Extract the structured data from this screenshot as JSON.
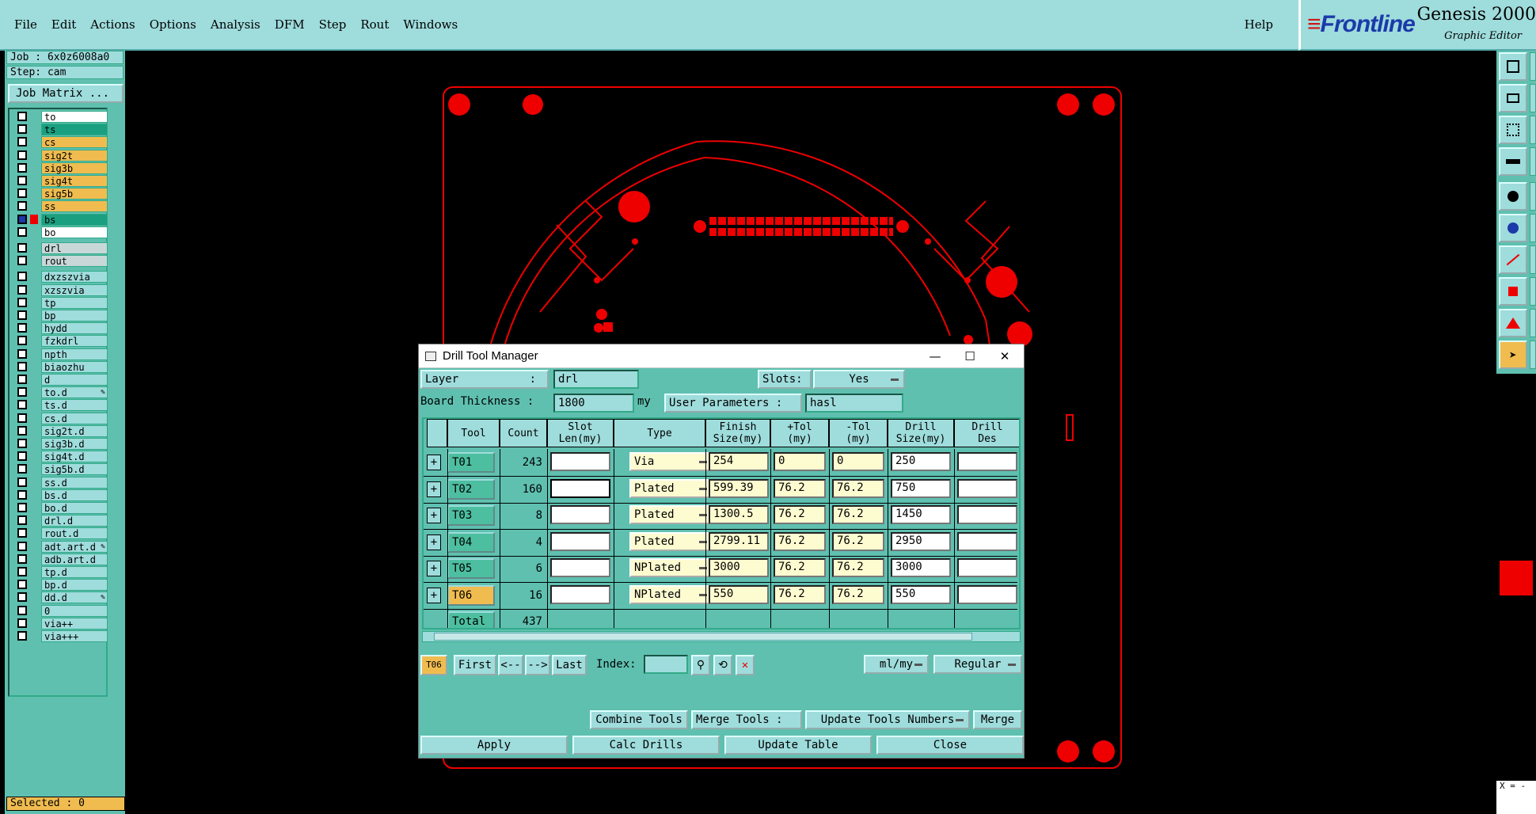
{
  "menubar": {
    "items": [
      "File",
      "Edit",
      "Actions",
      "Options",
      "Analysis",
      "DFM",
      "Step",
      "Rout",
      "Windows"
    ],
    "help": "Help"
  },
  "brand": {
    "logo": "Frontline",
    "product": "Genesis 2000",
    "subtitle": "Graphic Editor"
  },
  "job_info": {
    "job": "Job : 6x0z6008a0",
    "step": "Step: cam",
    "job_matrix_button": "Job Matrix ..."
  },
  "layers": [
    "to",
    "ts",
    "cs",
    "sig2t",
    "sig3b",
    "sig4t",
    "sig5b",
    "ss",
    "bs",
    "bo",
    "drl",
    "rout",
    "dxzszvia",
    "xzszvia",
    "tp",
    "bp",
    "hydd",
    "fzkdrl",
    "npth",
    "biaozhu",
    "d",
    "to.d",
    "ts.d",
    "cs.d",
    "sig2t.d",
    "sig3b.d",
    "sig4t.d",
    "sig5b.d",
    "ss.d",
    "bs.d",
    "bo.d",
    "drl.d",
    "rout.d",
    "adt.art.d",
    "adb.art.d",
    "tp.d",
    "bp.d",
    "dd.d",
    "0",
    "via++",
    "via+++"
  ],
  "selected": "Selected : 0",
  "coord_readout": "X = -",
  "dialog": {
    "title": "Drill Tool Manager",
    "layer_label": "Layer",
    "layer_colon": ":",
    "layer_value": "drl",
    "slots_label": "Slots:",
    "slots_value": "Yes",
    "board_thickness_label": "Board Thickness :",
    "board_thickness_value": "1800",
    "board_thickness_unit": "my",
    "user_params_label": "User Parameters :",
    "user_params_value": "hasl",
    "columns": [
      "Tool",
      "Count",
      "Slot\nLen(my)",
      "Type",
      "Finish\nSize(my)",
      "+Tol\n(my)",
      "-Tol\n(my)",
      "Drill\nSize(my)",
      "Drill\nDes"
    ],
    "rows": [
      {
        "tool": "T01",
        "count": "243",
        "type": "Via",
        "finish": "254",
        "ptol": "0",
        "ntol": "0",
        "drill": "250"
      },
      {
        "tool": "T02",
        "count": "160",
        "type": "Plated",
        "finish": "599.39",
        "ptol": "76.2",
        "ntol": "76.2",
        "drill": "750"
      },
      {
        "tool": "T03",
        "count": "8",
        "type": "Plated",
        "finish": "1300.5",
        "ptol": "76.2",
        "ntol": "76.2",
        "drill": "1450"
      },
      {
        "tool": "T04",
        "count": "4",
        "type": "Plated",
        "finish": "2799.11",
        "ptol": "76.2",
        "ntol": "76.2",
        "drill": "2950"
      },
      {
        "tool": "T05",
        "count": "6",
        "type": "NPlated",
        "finish": "3000",
        "ptol": "76.2",
        "ntol": "76.2",
        "drill": "3000"
      },
      {
        "tool": "T06",
        "count": "16",
        "type": "NPlated",
        "finish": "550",
        "ptol": "76.2",
        "ntol": "76.2",
        "drill": "550"
      }
    ],
    "total_label": "Total",
    "total_count": "437",
    "current_tool": "T06",
    "nav": {
      "first": "First",
      "prev": "<--",
      "next": "-->",
      "last": "Last",
      "index_label": "Index:"
    },
    "units_value": "ml/my",
    "mode_value": "Regular",
    "combine_tools": "Combine Tools",
    "merge_tools_label": "Merge Tools :",
    "update_tools_numbers": "Update Tools Numbers",
    "merge": "Merge",
    "apply": "Apply",
    "calc_drills": "Calc Drills",
    "update_table": "Update Table",
    "close": "Close"
  }
}
